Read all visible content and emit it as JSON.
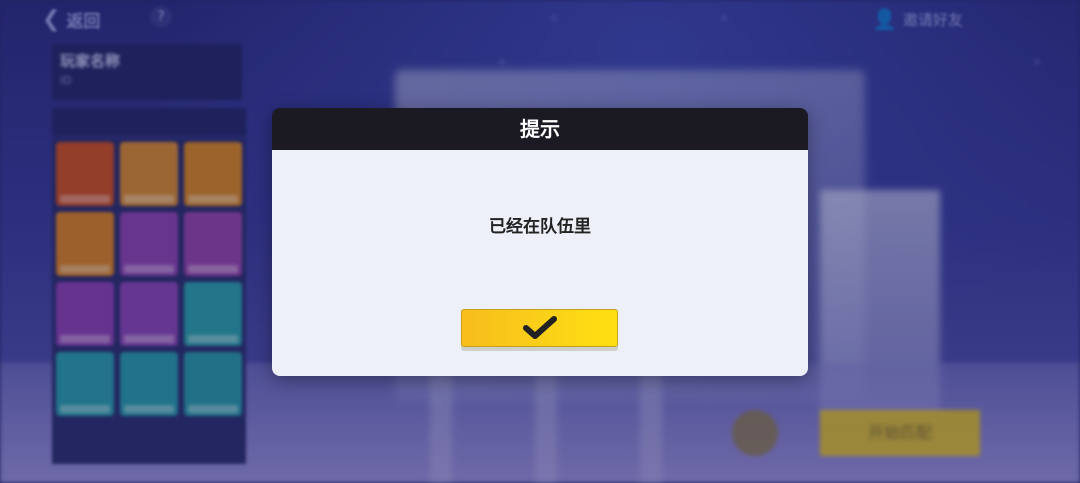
{
  "topbar": {
    "back_label": "返回",
    "help_glyph": "?",
    "friends_label": "邀请好友"
  },
  "player": {
    "name": "玩家名称",
    "sub": "ID"
  },
  "inventory": {
    "header": "",
    "slots": 12
  },
  "bottom": {
    "start_label": "开始匹配"
  },
  "dialog": {
    "title": "提示",
    "message": "已经在队伍里",
    "confirm_icon": "checkmark-icon"
  },
  "colors": {
    "dialog_header": "#1b1a22",
    "dialog_body": "#edf0f8",
    "button_yellow": "#fbcf19",
    "background": "#2c2f86"
  }
}
